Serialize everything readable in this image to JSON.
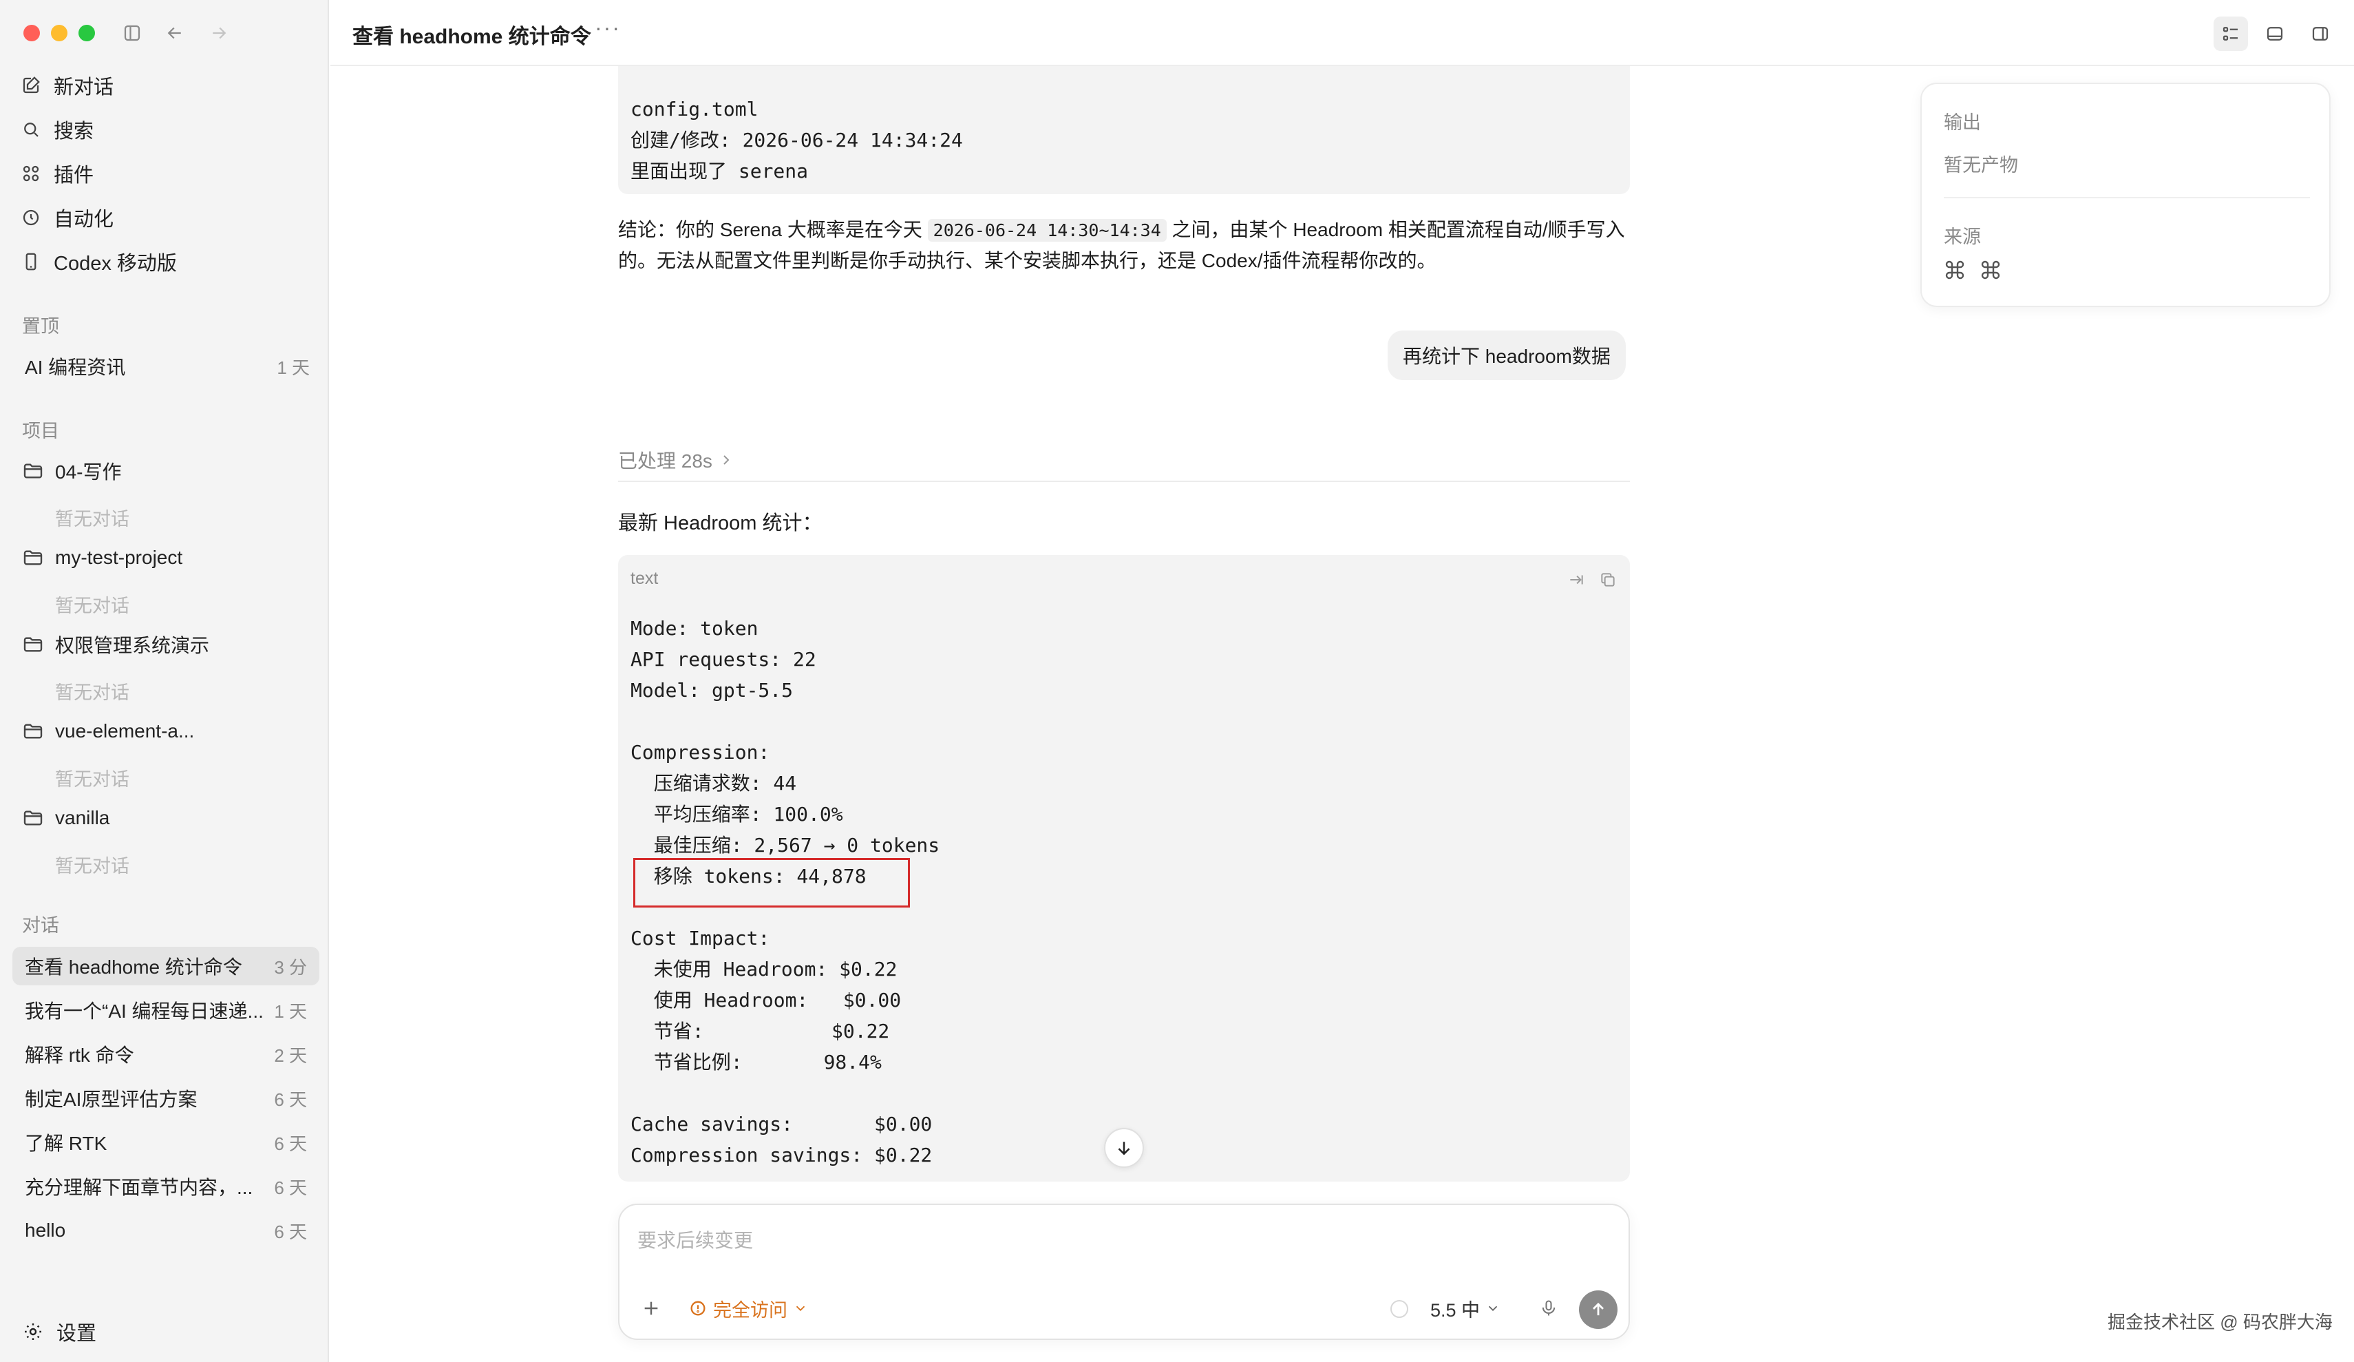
{
  "sidebar": {
    "nav": [
      {
        "label": "新对话",
        "icon": "new-chat-icon"
      },
      {
        "label": "搜索",
        "icon": "search-icon"
      },
      {
        "label": "插件",
        "icon": "plugins-icon"
      },
      {
        "label": "自动化",
        "icon": "automation-icon"
      },
      {
        "label": "Codex 移动版",
        "icon": "mobile-icon"
      }
    ],
    "pinned_label": "置顶",
    "pinned": [
      {
        "title": "AI 编程资讯",
        "age": "1 天"
      }
    ],
    "projects_label": "项目",
    "projects": [
      {
        "name": "04-写作",
        "empty": "暂无对话"
      },
      {
        "name": "my-test-project",
        "empty": "暂无对话"
      },
      {
        "name": "权限管理系统演示",
        "empty": "暂无对话"
      },
      {
        "name": "vue-element-a...",
        "empty": "暂无对话"
      },
      {
        "name": "vanilla",
        "empty": "暂无对话"
      }
    ],
    "conversations_label": "对话",
    "conversations": [
      {
        "title": "查看 headhome 统计命令",
        "age": "3 分"
      },
      {
        "title": "我有一个“AI 编程每日速递...",
        "age": "1 天"
      },
      {
        "title": "解释 rtk 命令",
        "age": "2 天"
      },
      {
        "title": "制定AI原型评估方案",
        "age": "6 天"
      },
      {
        "title": "了解 RTK",
        "age": "6 天"
      },
      {
        "title": "充分理解下面章节内容，...",
        "age": "6 天"
      },
      {
        "title": "hello",
        "age": "6 天"
      }
    ],
    "settings_label": "设置"
  },
  "header": {
    "title": "查看 headhome 统计命令",
    "more": "···"
  },
  "main": {
    "prev_code": [
      "config.toml",
      "创建/修改: 2026-06-24 14:34:24",
      "里面出现了 serena"
    ],
    "conclusion": {
      "before": "结论：你的 Serena 大概率是在今天 ",
      "code": "2026-06-24 14:30~14:34",
      "after": " 之间，由某个 Headroom 相关配置流程自动/顺手写入的。无法从配置文件里判断是你手动执行、某个安装脚本执行，还是 Codex/插件流程帮你改的。"
    },
    "user_message": "再统计下 headroom数据",
    "processed": "已处理 28s",
    "answer_title": "最新 Headroom 统计：",
    "code_lang": "text",
    "code_lines": [
      "Mode: token",
      "API requests: 22",
      "Model: gpt-5.5",
      "",
      "Compression:",
      "  压缩请求数: 44",
      "  平均压缩率: 100.0%",
      "  最佳压缩: 2,567 → 0 tokens",
      "  移除 tokens: 44,878",
      "",
      "Cost Impact:",
      "  未使用 Headroom: $0.22",
      "  使用 Headroom:   $0.00",
      "  节省:           $0.22",
      "  节省比例:       98.4%",
      "",
      "Cache savings:       $0.00",
      "Compression savings: $0.22"
    ]
  },
  "composer": {
    "placeholder": "要求后续变更",
    "access_label": "完全访问",
    "model_label": "5.5 中"
  },
  "right_panel": {
    "output_label": "输出",
    "output_empty": "暂无产物",
    "source_label": "来源"
  },
  "watermark": "掘金技术社区 @ 码农胖大海",
  "colors": {
    "accent_warning": "#d9731e",
    "highlight_border": "#d52b2b"
  }
}
